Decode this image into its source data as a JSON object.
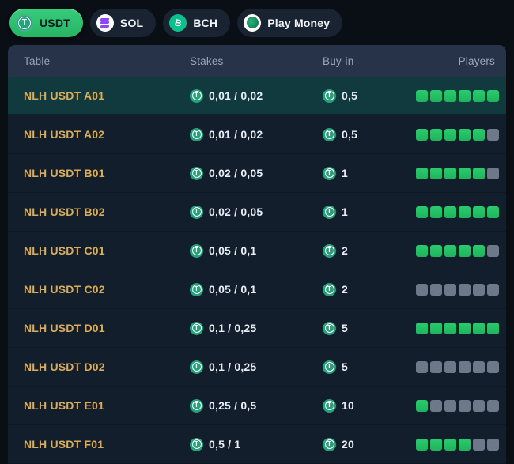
{
  "tabs": [
    {
      "label": "USDT",
      "icon": "usdt-coin",
      "active": true
    },
    {
      "label": "SOL",
      "icon": "solana-coin",
      "active": false
    },
    {
      "label": "BCH",
      "icon": "bch-coin",
      "active": false
    },
    {
      "label": "Play Money",
      "icon": "play-money-coin",
      "active": false
    }
  ],
  "lobby_table": {
    "headers": {
      "table": "Table",
      "stakes": "Stakes",
      "buyin": "Buy-in",
      "players": "Players"
    },
    "currency_symbol": "T",
    "bch_symbol": "B",
    "seats_total": 6,
    "rows": [
      {
        "name": "NLH USDT A01",
        "stakes": "0,01 / 0,02",
        "buyin": "0,5",
        "seats_taken": 6,
        "selected": true
      },
      {
        "name": "NLH USDT A02",
        "stakes": "0,01 / 0,02",
        "buyin": "0,5",
        "seats_taken": 5,
        "selected": false
      },
      {
        "name": "NLH USDT B01",
        "stakes": "0,02 / 0,05",
        "buyin": "1",
        "seats_taken": 5,
        "selected": false
      },
      {
        "name": "NLH USDT B02",
        "stakes": "0,02 / 0,05",
        "buyin": "1",
        "seats_taken": 6,
        "selected": false
      },
      {
        "name": "NLH USDT C01",
        "stakes": "0,05 / 0,1",
        "buyin": "2",
        "seats_taken": 5,
        "selected": false
      },
      {
        "name": "NLH USDT C02",
        "stakes": "0,05 / 0,1",
        "buyin": "2",
        "seats_taken": 0,
        "selected": false
      },
      {
        "name": "NLH USDT D01",
        "stakes": "0,1 / 0,25",
        "buyin": "5",
        "seats_taken": 6,
        "selected": false
      },
      {
        "name": "NLH USDT D02",
        "stakes": "0,1 / 0,25",
        "buyin": "5",
        "seats_taken": 0,
        "selected": false
      },
      {
        "name": "NLH USDT E01",
        "stakes": "0,25 / 0,5",
        "buyin": "10",
        "seats_taken": 1,
        "selected": false
      },
      {
        "name": "NLH USDT F01",
        "stakes": "0,5 / 1",
        "buyin": "20",
        "seats_taken": 4,
        "selected": false
      }
    ]
  },
  "colors": {
    "accent_green": "#2ebd6f",
    "tether_teal": "#26a17b",
    "solana_purple": "#8f45ff",
    "bch_green": "#0ac18e",
    "seat_filled": "#22bd64",
    "seat_empty": "#6d7888",
    "table_name_gold": "#d9ad5c",
    "header_bg": "#263349",
    "row_bg": "#121e2c",
    "selected_row_bg": "#113a3e",
    "page_bg": "#0a0e15"
  }
}
